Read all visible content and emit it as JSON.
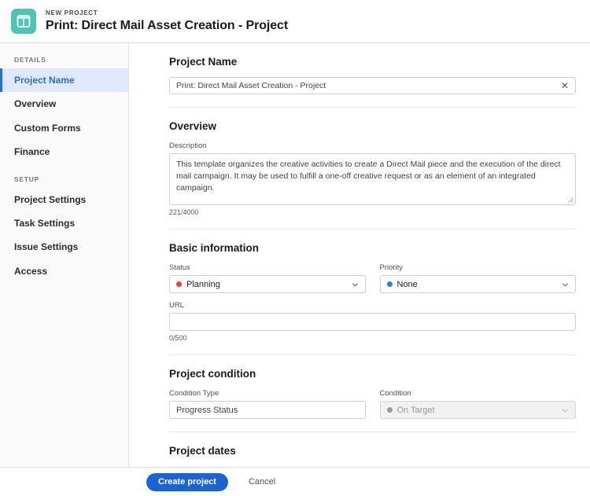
{
  "header": {
    "eyebrow": "NEW PROJECT",
    "title": "Print: Direct Mail Asset Creation - Project",
    "icon": "template-layout-icon",
    "icon_color": "#4ec4b4"
  },
  "sidebar": {
    "groups": [
      {
        "label": "DETAILS",
        "items": [
          {
            "label": "Project Name",
            "active": true
          },
          {
            "label": "Overview",
            "active": false
          },
          {
            "label": "Custom Forms",
            "active": false
          },
          {
            "label": "Finance",
            "active": false
          }
        ]
      },
      {
        "label": "SETUP",
        "items": [
          {
            "label": "Project Settings",
            "active": false
          },
          {
            "label": "Task Settings",
            "active": false
          },
          {
            "label": "Issue Settings",
            "active": false
          },
          {
            "label": "Access",
            "active": false
          }
        ]
      }
    ],
    "accent_color": "#2c6ecb"
  },
  "main": {
    "project_name": {
      "section_title": "Project Name",
      "value": "Print: Direct Mail Asset Creation - Project",
      "placeholder": "",
      "clear_icon": "close-icon"
    },
    "overview": {
      "section_title": "Overview",
      "description_label": "Description",
      "description_value": "This template organizes the creative activities to create a Direct Mail piece and the execution of the direct mail campaign. It may be used to fulfill a one-off creative request or as an element of an integrated campaign.",
      "description_placeholder": "",
      "description_counter": "221/4000"
    },
    "basic_information": {
      "section_title": "Basic information",
      "status_label": "Status",
      "status_value": "Planning",
      "status_dot_color": "#f0413d",
      "priority_label": "Priority",
      "priority_value": "None",
      "priority_dot_color": "#3377e8",
      "url_label": "URL",
      "url_value": "",
      "url_placeholder": "",
      "url_counter": "0/500"
    },
    "project_condition": {
      "section_title": "Project condition",
      "condition_type_label": "Condition Type",
      "condition_type_value": "Progress Status",
      "condition_label": "Condition",
      "condition_value": "On Target",
      "condition_dot_color": "#9a9a9a"
    },
    "project_dates": {
      "section_title": "Project dates"
    }
  },
  "footer": {
    "create_label": "Create project",
    "cancel_label": "Cancel",
    "primary_color": "#1b63d4"
  }
}
